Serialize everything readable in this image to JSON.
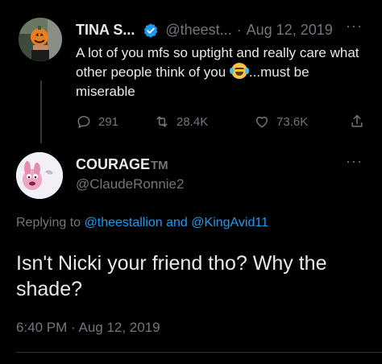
{
  "parent_tweet": {
    "display_name": "TINA S...",
    "handle": "@theest...",
    "separator": "·",
    "date": "Aug 12, 2019",
    "more_label": "···",
    "text_part1": "A lot of you mfs so uptight and really care what other people think of you ",
    "emoji_name": "face-with-tears-of-joy-icon",
    "text_part2": "...must be miserable",
    "replies": "291",
    "retweets": "28.4K",
    "likes": "73.6K"
  },
  "reply_tweet": {
    "display_name": "COURAGE",
    "display_name_suffix": "TM",
    "handle": "@ClaudeRonnie2",
    "more_label": "···",
    "replying_prefix": "Replying to ",
    "mention1": "@theestallion",
    "mention_joiner": " and ",
    "mention2": "@KingAvid11",
    "text": "Isn't Nicki your friend tho? Why the shade?",
    "time": "6:40 PM",
    "separator": " · ",
    "date": "Aug 12, 2019"
  },
  "colors": {
    "background": "#000000",
    "text": "#e7e9ea",
    "muted": "#71767b",
    "link": "#1d9bf0",
    "verified": "#1d9bf0"
  }
}
